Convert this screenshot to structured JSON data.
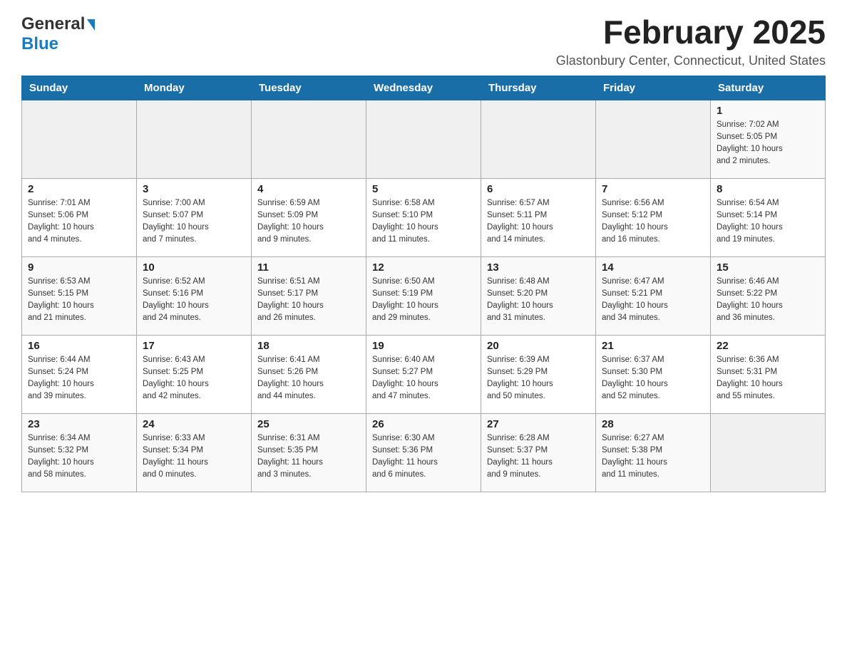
{
  "header": {
    "logo_general": "General",
    "logo_blue": "Blue",
    "month_title": "February 2025",
    "location": "Glastonbury Center, Connecticut, United States"
  },
  "days_of_week": [
    "Sunday",
    "Monday",
    "Tuesday",
    "Wednesday",
    "Thursday",
    "Friday",
    "Saturday"
  ],
  "weeks": [
    [
      {
        "day": "",
        "info": ""
      },
      {
        "day": "",
        "info": ""
      },
      {
        "day": "",
        "info": ""
      },
      {
        "day": "",
        "info": ""
      },
      {
        "day": "",
        "info": ""
      },
      {
        "day": "",
        "info": ""
      },
      {
        "day": "1",
        "info": "Sunrise: 7:02 AM\nSunset: 5:05 PM\nDaylight: 10 hours\nand 2 minutes."
      }
    ],
    [
      {
        "day": "2",
        "info": "Sunrise: 7:01 AM\nSunset: 5:06 PM\nDaylight: 10 hours\nand 4 minutes."
      },
      {
        "day": "3",
        "info": "Sunrise: 7:00 AM\nSunset: 5:07 PM\nDaylight: 10 hours\nand 7 minutes."
      },
      {
        "day": "4",
        "info": "Sunrise: 6:59 AM\nSunset: 5:09 PM\nDaylight: 10 hours\nand 9 minutes."
      },
      {
        "day": "5",
        "info": "Sunrise: 6:58 AM\nSunset: 5:10 PM\nDaylight: 10 hours\nand 11 minutes."
      },
      {
        "day": "6",
        "info": "Sunrise: 6:57 AM\nSunset: 5:11 PM\nDaylight: 10 hours\nand 14 minutes."
      },
      {
        "day": "7",
        "info": "Sunrise: 6:56 AM\nSunset: 5:12 PM\nDaylight: 10 hours\nand 16 minutes."
      },
      {
        "day": "8",
        "info": "Sunrise: 6:54 AM\nSunset: 5:14 PM\nDaylight: 10 hours\nand 19 minutes."
      }
    ],
    [
      {
        "day": "9",
        "info": "Sunrise: 6:53 AM\nSunset: 5:15 PM\nDaylight: 10 hours\nand 21 minutes."
      },
      {
        "day": "10",
        "info": "Sunrise: 6:52 AM\nSunset: 5:16 PM\nDaylight: 10 hours\nand 24 minutes."
      },
      {
        "day": "11",
        "info": "Sunrise: 6:51 AM\nSunset: 5:17 PM\nDaylight: 10 hours\nand 26 minutes."
      },
      {
        "day": "12",
        "info": "Sunrise: 6:50 AM\nSunset: 5:19 PM\nDaylight: 10 hours\nand 29 minutes."
      },
      {
        "day": "13",
        "info": "Sunrise: 6:48 AM\nSunset: 5:20 PM\nDaylight: 10 hours\nand 31 minutes."
      },
      {
        "day": "14",
        "info": "Sunrise: 6:47 AM\nSunset: 5:21 PM\nDaylight: 10 hours\nand 34 minutes."
      },
      {
        "day": "15",
        "info": "Sunrise: 6:46 AM\nSunset: 5:22 PM\nDaylight: 10 hours\nand 36 minutes."
      }
    ],
    [
      {
        "day": "16",
        "info": "Sunrise: 6:44 AM\nSunset: 5:24 PM\nDaylight: 10 hours\nand 39 minutes."
      },
      {
        "day": "17",
        "info": "Sunrise: 6:43 AM\nSunset: 5:25 PM\nDaylight: 10 hours\nand 42 minutes."
      },
      {
        "day": "18",
        "info": "Sunrise: 6:41 AM\nSunset: 5:26 PM\nDaylight: 10 hours\nand 44 minutes."
      },
      {
        "day": "19",
        "info": "Sunrise: 6:40 AM\nSunset: 5:27 PM\nDaylight: 10 hours\nand 47 minutes."
      },
      {
        "day": "20",
        "info": "Sunrise: 6:39 AM\nSunset: 5:29 PM\nDaylight: 10 hours\nand 50 minutes."
      },
      {
        "day": "21",
        "info": "Sunrise: 6:37 AM\nSunset: 5:30 PM\nDaylight: 10 hours\nand 52 minutes."
      },
      {
        "day": "22",
        "info": "Sunrise: 6:36 AM\nSunset: 5:31 PM\nDaylight: 10 hours\nand 55 minutes."
      }
    ],
    [
      {
        "day": "23",
        "info": "Sunrise: 6:34 AM\nSunset: 5:32 PM\nDaylight: 10 hours\nand 58 minutes."
      },
      {
        "day": "24",
        "info": "Sunrise: 6:33 AM\nSunset: 5:34 PM\nDaylight: 11 hours\nand 0 minutes."
      },
      {
        "day": "25",
        "info": "Sunrise: 6:31 AM\nSunset: 5:35 PM\nDaylight: 11 hours\nand 3 minutes."
      },
      {
        "day": "26",
        "info": "Sunrise: 6:30 AM\nSunset: 5:36 PM\nDaylight: 11 hours\nand 6 minutes."
      },
      {
        "day": "27",
        "info": "Sunrise: 6:28 AM\nSunset: 5:37 PM\nDaylight: 11 hours\nand 9 minutes."
      },
      {
        "day": "28",
        "info": "Sunrise: 6:27 AM\nSunset: 5:38 PM\nDaylight: 11 hours\nand 11 minutes."
      },
      {
        "day": "",
        "info": ""
      }
    ]
  ]
}
